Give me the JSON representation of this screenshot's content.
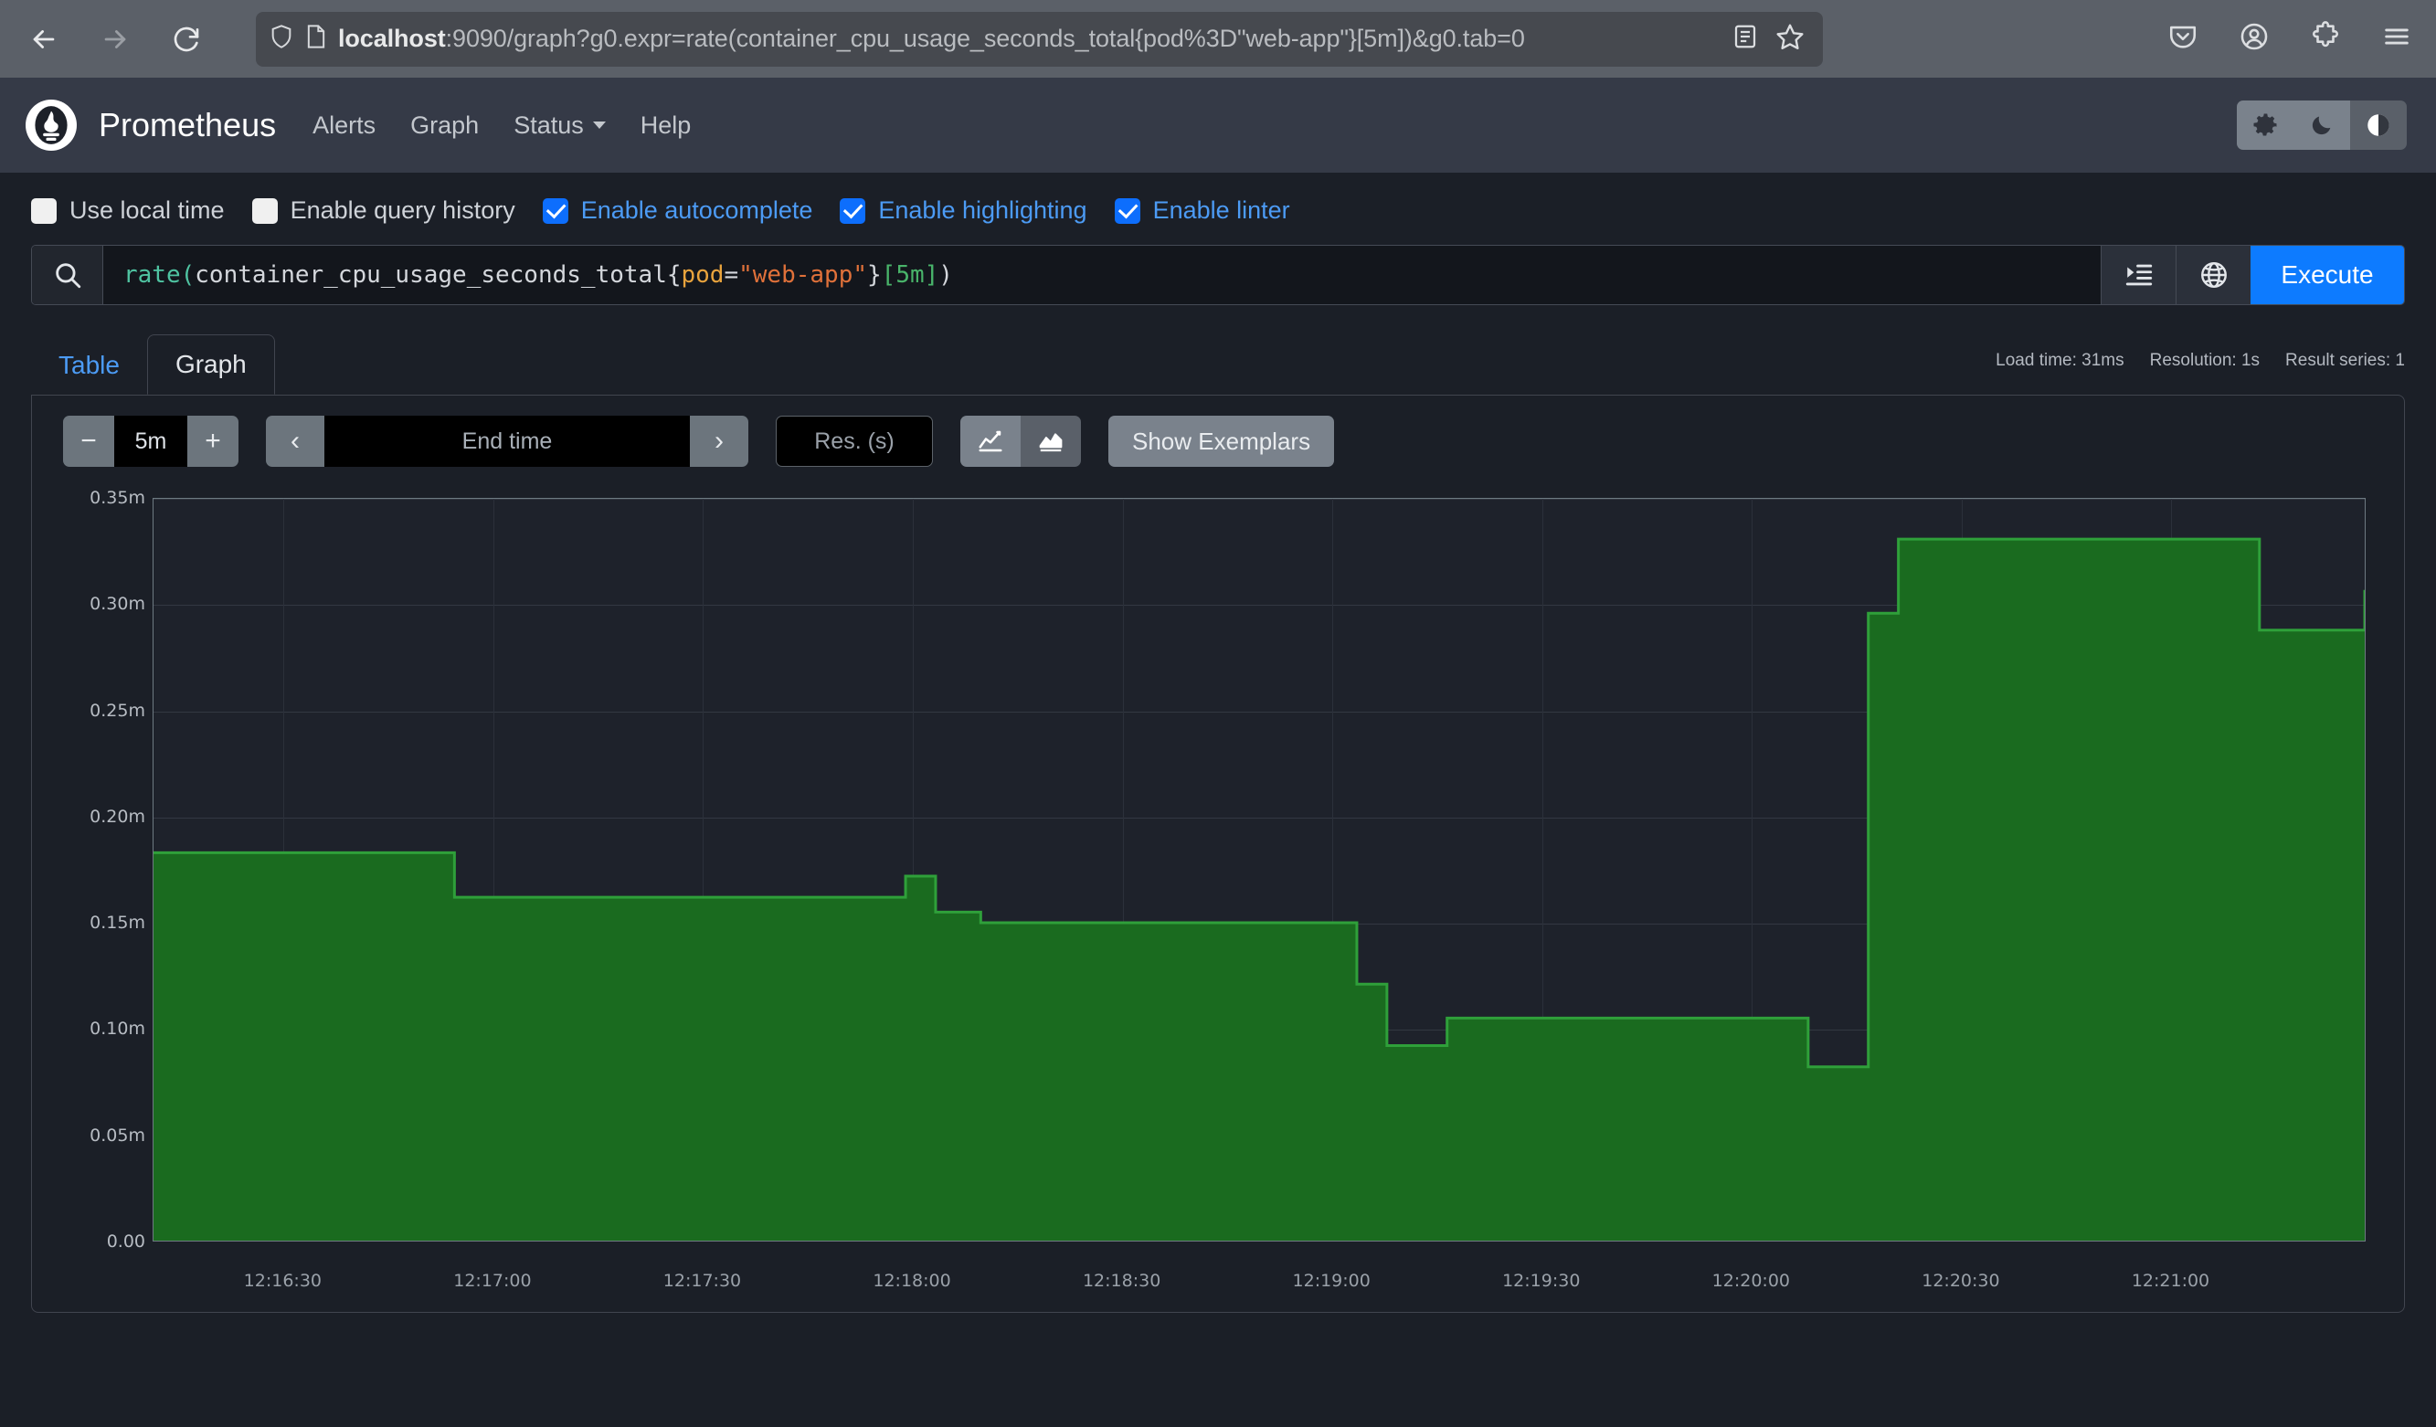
{
  "browser": {
    "url_main": "localhost",
    "url_rest": ":9090/graph?g0.expr=rate(container_cpu_usage_seconds_total{pod%3D\"web-app\"}[5m])&g0.tab=0",
    "back_icon": "back-arrow-icon",
    "forward_icon": "forward-arrow-icon",
    "reload_icon": "reload-icon",
    "shield_icon": "shield-icon",
    "page_icon": "page-icon",
    "reader_icon": "reader-view-icon",
    "bookmark_icon": "star-bookmark-icon",
    "pocket_icon": "pocket-icon",
    "account_icon": "account-icon",
    "extensions_icon": "extensions-puzzle-icon",
    "menu_icon": "hamburger-menu-icon"
  },
  "navbar": {
    "brand": "Prometheus",
    "logo_icon": "prometheus-logo-icon",
    "links": [
      {
        "label": "Alerts",
        "dropdown": false
      },
      {
        "label": "Graph",
        "dropdown": false
      },
      {
        "label": "Status",
        "dropdown": true
      },
      {
        "label": "Help",
        "dropdown": false
      }
    ],
    "theme_buttons": [
      {
        "name": "theme-light",
        "icon": "gear-icon",
        "active": false
      },
      {
        "name": "theme-dark",
        "icon": "moon-icon",
        "active": false
      },
      {
        "name": "theme-auto",
        "icon": "half-circle-contrast-icon",
        "active": true
      }
    ]
  },
  "options": [
    {
      "label": "Use local time",
      "checked": false
    },
    {
      "label": "Enable query history",
      "checked": false
    },
    {
      "label": "Enable autocomplete",
      "checked": true
    },
    {
      "label": "Enable highlighting",
      "checked": true
    },
    {
      "label": "Enable linter",
      "checked": true
    }
  ],
  "query": {
    "search_icon": "search-icon",
    "expression": "rate(container_cpu_usage_seconds_total{pod=\"web-app\"}[5m])",
    "tokens": {
      "fn": "rate(",
      "metric": "container_cpu_usage_seconds_total",
      "brace_open": "{",
      "label_key": "pod",
      "eq": "=",
      "label_value": "\"web-app\"",
      "brace_close": "}",
      "duration": "[5m]",
      "paren_close": ")"
    },
    "metrics_explorer_icon": "metrics-explorer-icon",
    "globe_icon": "globe-icon",
    "execute_label": "Execute"
  },
  "tabs": [
    {
      "label": "Table",
      "active": false
    },
    {
      "label": "Graph",
      "active": true
    }
  ],
  "stats": {
    "load_time": "Load time: 31ms",
    "resolution": "Resolution: 1s",
    "result_series": "Result series: 1"
  },
  "graph_tools": {
    "decrease_label": "−",
    "range_value": "5m",
    "increase_label": "+",
    "prev_label": "‹",
    "end_time_placeholder": "End time",
    "next_label": "›",
    "resolution_placeholder": "Res. (s)",
    "chart_types": [
      {
        "name": "line-chart-toggle",
        "icon": "line-chart-icon",
        "active": false
      },
      {
        "name": "stacked-chart-toggle",
        "icon": "stacked-area-chart-icon",
        "active": true
      }
    ],
    "exemplars_label": "Show Exemplars"
  },
  "chart_data": {
    "type": "area",
    "title": "",
    "xlabel": "",
    "ylabel": "",
    "ylim": [
      0,
      0.00035
    ],
    "y_ticks": [
      "0.00",
      "0.05m",
      "0.10m",
      "0.15m",
      "0.20m",
      "0.25m",
      "0.30m",
      "0.35m"
    ],
    "y_tick_values": [
      0,
      5e-05,
      0.0001,
      0.00015,
      0.0002,
      0.00025,
      0.0003,
      0.00035
    ],
    "x_ticks": [
      "12:16:30",
      "12:17:00",
      "12:17:30",
      "12:18:00",
      "12:18:30",
      "12:19:00",
      "12:19:30",
      "12:20:00",
      "12:20:30",
      "12:21:00"
    ],
    "grid": true,
    "legend": "none",
    "series": [
      {
        "name": "rate(container_cpu_usage_seconds_total{pod=\"web-app\"}[5m])",
        "color": "#1a6b1f",
        "stroke": "#2fa03a",
        "x": [
          "12:16:12",
          "12:16:50",
          "12:16:52",
          "12:17:50",
          "12:17:52",
          "12:17:56",
          "12:18:02",
          "12:18:52",
          "12:18:56",
          "12:19:00",
          "12:19:04",
          "12:19:52",
          "12:19:56",
          "12:20:00",
          "12:20:04",
          "12:20:48",
          "12:20:52",
          "12:21:00",
          "12:21:06"
        ],
        "values": [
          0.000183,
          0.000183,
          0.000162,
          0.000162,
          0.000172,
          0.000155,
          0.00015,
          0.000121,
          9.2e-05,
          9.2e-05,
          0.000105,
          8.2e-05,
          8.2e-05,
          0.000296,
          0.000331,
          0.000331,
          0.000288,
          0.000288,
          0.000307
        ]
      }
    ]
  }
}
